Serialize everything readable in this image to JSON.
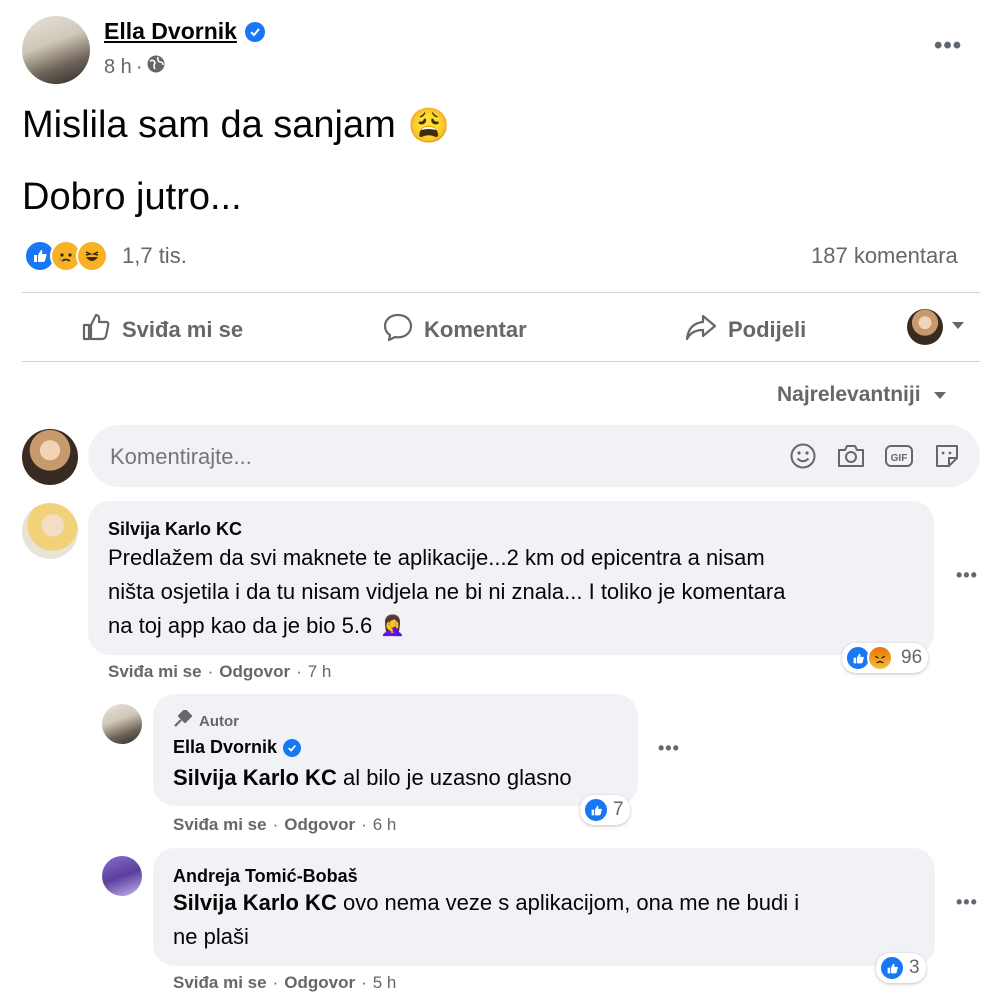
{
  "post": {
    "author": "Ella Dvornik",
    "time": "8 h",
    "separator": "·",
    "line1": "Mislila sam da sanjam",
    "emoji": "😩",
    "line2": "Dobro jutro...",
    "reaction_count": "1,7 tis.",
    "comment_count": "187 komentara",
    "reactions": [
      "like-icon",
      "sad-icon",
      "haha-icon"
    ]
  },
  "actions": {
    "like": "Sviđa mi se",
    "comment": "Komentar",
    "share": "Podijeli"
  },
  "sort": {
    "label": "Najrelevantniji"
  },
  "composer": {
    "placeholder": "Komentirajte...",
    "icons": [
      "emoji-icon",
      "camera-icon",
      "gif-icon",
      "sticker-icon"
    ]
  },
  "comments": [
    {
      "author": "Silvija Karlo KC",
      "lines": [
        "Predlažem da svi maknete te aplikacije...2 km od epicentra a nisam",
        "ništa osjetila i da tu nisam vidjela ne bi ni znala... I toliko je komentara",
        "na toj app kao da je bio 5.6"
      ],
      "emoji": "🤦‍♀️",
      "like": "Sviđa mi se",
      "reply": "Odgovor",
      "time": "7 h",
      "reaction_count": "96"
    },
    {
      "badge": "Autor",
      "author": "Ella Dvornik",
      "mention": "Silvija Karlo KC",
      "text": " al bilo je uzasno glasno",
      "like": "Sviđa mi se",
      "reply": "Odgovor",
      "time": "6 h",
      "reaction_count": "7"
    },
    {
      "author": "Andreja Tomić-Bobaš",
      "mention": "Silvija Karlo KC",
      "text": " ovo nema veze s aplikacijom, ona me ne budi i",
      "line2": "ne plaši",
      "like": "Sviđa mi se",
      "reply": "Odgovor",
      "time": "5 h",
      "reaction_count": "3"
    }
  ],
  "colors": {
    "accent": "#1877f2",
    "muted": "#65676b",
    "bubble": "#f0f2f5"
  }
}
